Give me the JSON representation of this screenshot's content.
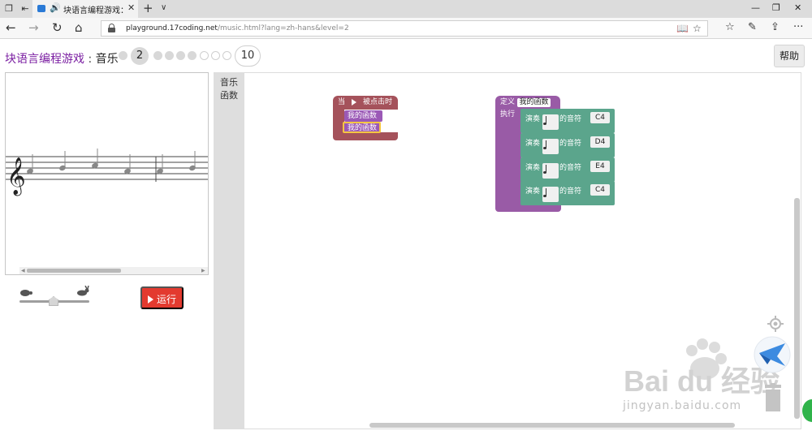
{
  "browser": {
    "tab_title": "块语言编程游戏：音",
    "url_host": "playground.17coding.net",
    "url_path": "/music.html?lang=zh-hans&level=2"
  },
  "game": {
    "title": "块语言编程游戏",
    "separator": " : ",
    "level_name": "音乐",
    "current_level": "2",
    "last_level": "10",
    "help_label": "帮助",
    "run_label": "运行"
  },
  "toolbox": {
    "categories": [
      "音乐",
      "函数"
    ]
  },
  "blocks": {
    "event": {
      "when": "当",
      "clicked": "被点击时"
    },
    "calls": [
      "我的函数",
      "我的函数"
    ],
    "definition": {
      "define": "定义",
      "name": "我的函数",
      "do": "执行"
    },
    "play_prefix": "演奏",
    "note_suffix": "的音符",
    "notes": [
      "C4",
      "D4",
      "E4",
      "C4"
    ]
  },
  "watermark": {
    "text": "Bai du 经验",
    "sub": "jingyan.baidu.com"
  },
  "colors": {
    "title_purple": "#7b1fa2",
    "run_red": "#e33a2f",
    "event_block": "#a5525b",
    "function_block": "#995ba6",
    "music_block": "#5ba58c"
  }
}
